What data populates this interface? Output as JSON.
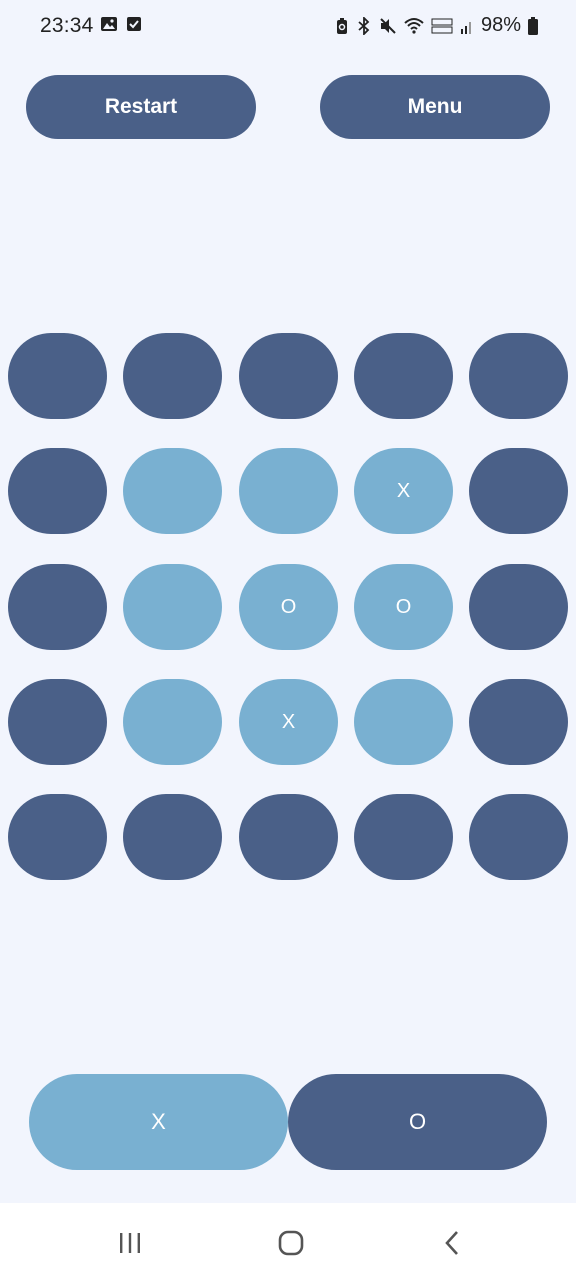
{
  "status_bar": {
    "time": "23:34",
    "battery_percent": "98%",
    "left_icons": [
      "image-icon",
      "checkbox-icon"
    ],
    "right_icons": [
      "battery-saver-icon",
      "bluetooth-icon",
      "mute-icon",
      "wifi-icon",
      "volte-icon",
      "signal-icon",
      "battery-icon"
    ]
  },
  "top_buttons": {
    "restart_label": "Restart",
    "menu_label": "Menu"
  },
  "board": {
    "rows": 5,
    "cols": 5,
    "cells": [
      [
        "",
        "",
        "",
        "",
        ""
      ],
      [
        "",
        "",
        "",
        "X",
        ""
      ],
      [
        "",
        "",
        "O",
        "O",
        ""
      ],
      [
        "",
        "",
        "X",
        "",
        ""
      ],
      [
        "",
        "",
        "",
        "",
        ""
      ]
    ],
    "active_region": [
      [
        false,
        false,
        false,
        false,
        false
      ],
      [
        false,
        true,
        true,
        true,
        false
      ],
      [
        false,
        true,
        true,
        true,
        false
      ],
      [
        false,
        true,
        true,
        true,
        false
      ],
      [
        false,
        false,
        false,
        false,
        false
      ]
    ]
  },
  "turn_selector": {
    "x_label": "X",
    "o_label": "O",
    "selected": "X"
  },
  "colors": {
    "background": "#f2f5fd",
    "dark_cell": "#4a6088",
    "light_cell": "#79b0d1",
    "text": "#ffffff"
  }
}
